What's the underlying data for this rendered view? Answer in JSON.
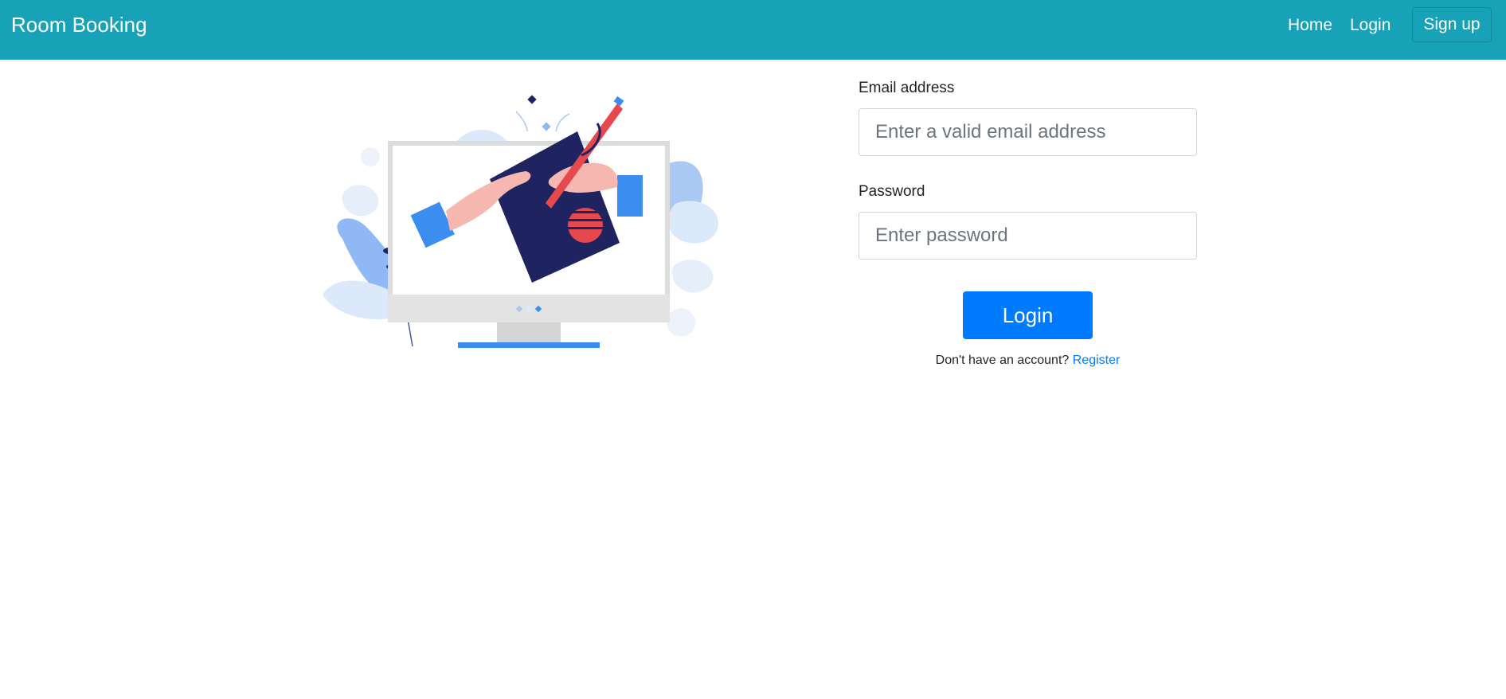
{
  "navbar": {
    "brand": "Room Booking",
    "links": [
      {
        "label": "Home"
      },
      {
        "label": "Login"
      },
      {
        "label": "Sign up"
      }
    ],
    "color": "#17a2b8"
  },
  "form": {
    "email": {
      "label": "Email address",
      "placeholder": "Enter a valid email address",
      "value": ""
    },
    "password": {
      "label": "Password",
      "placeholder": "Enter password",
      "value": ""
    },
    "submit_label": "Login",
    "signup_prompt": "Don't have an account?",
    "register_link": "Register",
    "button_color": "#007bff"
  },
  "illustration": {
    "icon": "monitor-hands-drawing-illustration"
  }
}
